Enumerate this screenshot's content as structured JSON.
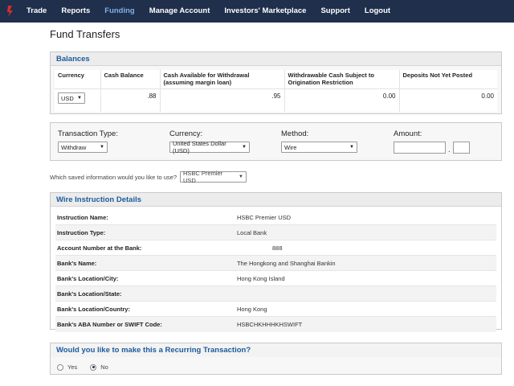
{
  "nav": {
    "items": [
      "Trade",
      "Reports",
      "Funding",
      "Manage Account",
      "Investors' Marketplace",
      "Support",
      "Logout"
    ],
    "active": "Funding",
    "logo_color": "#d0302e"
  },
  "page": {
    "title": "Fund Transfers"
  },
  "balances": {
    "heading": "Balances",
    "headers": [
      "Currency",
      "Cash Balance",
      "Cash Available for Withdrawal (assuming margin loan)",
      "Withdrawable Cash Subject to Origination Restriction",
      "Deposits Not Yet Posted"
    ],
    "row": {
      "currency": "USD",
      "cash_balance": ".88",
      "cash_available": ".95",
      "withdrawable_restricted": "0.00",
      "deposits_not_posted": "0.00"
    }
  },
  "transaction": {
    "type_label": "Transaction Type:",
    "type_value": "Withdraw",
    "currency_label": "Currency:",
    "currency_value": "United States Dollar (USD)",
    "method_label": "Method:",
    "method_value": "Wire",
    "amount_label": "Amount:",
    "amount_whole": "",
    "amount_cents": "",
    "amount_separator": "."
  },
  "saved": {
    "question": "Which saved information would you like to use?",
    "value": "HSBC Premier USD"
  },
  "wire": {
    "heading": "Wire Instruction Details",
    "rows": [
      {
        "k": "Instruction Name:",
        "v": "HSBC Premier USD"
      },
      {
        "k": "Instruction Type:",
        "v": "Local Bank"
      },
      {
        "k": "Account Number at the Bank:",
        "v": "888"
      },
      {
        "k": "Bank's Name:",
        "v": "The Hongkong and Shanghai Bankin"
      },
      {
        "k": "Bank's Location/City:",
        "v": "Hong Kong Island"
      },
      {
        "k": "Bank's Location/State:",
        "v": ""
      },
      {
        "k": "Bank's Location/Country:",
        "v": "Hong Kong"
      },
      {
        "k": "Bank's ABA Number or SWIFT Code:",
        "v": "HSBCHKHHHKHSWIFT"
      }
    ]
  },
  "recurring": {
    "heading": "Would you like to make this a Recurring Transaction?",
    "yes_label": "Yes",
    "no_label": "No",
    "selected": "No"
  }
}
